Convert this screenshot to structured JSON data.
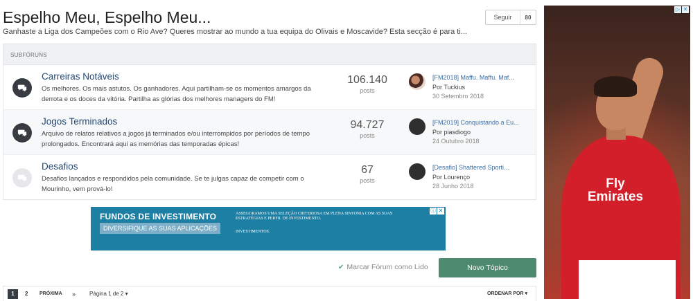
{
  "header": {
    "title": "Espelho Meu, Espelho Meu...",
    "description": "Ganhaste a Liga dos Campeões com o Rio Ave? Queres mostrar ao mundo a tua equipa do Olivais e Moscavide? Esta secção é para ti...",
    "follow_label": "Seguir",
    "follow_count": "80"
  },
  "subforums": {
    "heading": "SUBFÓRUNS",
    "rows": [
      {
        "title": "Carreiras Notáveis",
        "description": "Os melhores. Os mais astutos. Os ganhadores. Aqui partilham-se os momentos amargos da derrota e os doces da vitória. Partilha as glórias dos melhores managers do FM!",
        "count": "106.140",
        "unit": "posts",
        "last_title": "[FM2018] Maffu. Maffu. Maf...",
        "last_by": "Por Tuckius",
        "last_date": "30 Setembro 2018",
        "icon": "chat-bubble-icon",
        "unread": true
      },
      {
        "title": "Jogos Terminados",
        "description": "Arquivo de relatos relativos a jogos já terminados e/ou interrompidos por períodos de tempo prolongados. Encontrará aqui as memórias das temporadas épicas!",
        "count": "94.727",
        "unit": "posts",
        "last_title": "[FM2019] Conquistando a Eu...",
        "last_by": "Por piasdiogo",
        "last_date": "24 Outubro 2018",
        "icon": "chat-bubble-icon",
        "unread": true
      },
      {
        "title": "Desafios",
        "description": "Desafios lançados e respondidos pela comunidade. Se te julgas capaz de competir com o Mourinho, vem prová-lo!",
        "count": "67",
        "unit": "posts",
        "last_title": "[Desafio] Shattered Sporti...",
        "last_by": "Por Lourenço",
        "last_date": "28 Junho 2018",
        "icon": "chat-bubble-icon",
        "unread": false
      }
    ]
  },
  "ad_banner": {
    "title": "FUNDOS DE INVESTIMENTO",
    "subtitle": "DIVERSIFIQUE AS SUAS APLICAÇÕES",
    "text": "ASSEGURAMOS UMA SELEÇÃO CRITERIOSA EM PLENA SINTONIA COM AS SUAS ESTRATÉGIAS E PERFIL DE INVESTIMENTO.",
    "text2": "INVESTIMENTOS."
  },
  "actions": {
    "mark_read": "Marcar Fórum como Lido",
    "new_topic": "Novo Tópico"
  },
  "pagination": {
    "current": "1",
    "page2": "2",
    "next": "PRÓXIMA",
    "last": "»",
    "page_of": "Página 1 de 2 ▾",
    "sort": "ORDENAR POR ▾"
  },
  "side_ad": {
    "sponsor": "Fly Emirates"
  },
  "colors": {
    "accent": "#4e8a6f",
    "link": "#244a76",
    "ad_blue": "#1d7fa4"
  }
}
